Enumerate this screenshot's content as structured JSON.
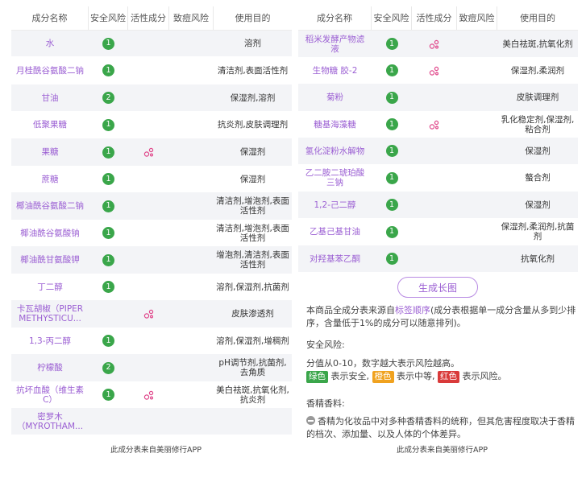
{
  "headers": {
    "name": "成分名称",
    "risk": "安全风险",
    "active": "活性成分",
    "acne": "致痘风险",
    "purpose": "使用目的"
  },
  "left_table": [
    {
      "name": "水",
      "risk": "1",
      "active": false,
      "purpose": "溶剂"
    },
    {
      "name": "月桂酰谷氨酸二钠",
      "risk": "1",
      "active": false,
      "purpose": "清洁剂,表面活性剂"
    },
    {
      "name": "甘油",
      "risk": "2",
      "active": false,
      "purpose": "保湿剂,溶剂"
    },
    {
      "name": "低聚果糖",
      "risk": "1",
      "active": false,
      "purpose": "抗炎剂,皮肤调理剂"
    },
    {
      "name": "果糖",
      "risk": "1",
      "active": true,
      "purpose": "保湿剂"
    },
    {
      "name": "蔗糖",
      "risk": "1",
      "active": false,
      "purpose": "保湿剂"
    },
    {
      "name": "椰油酰谷氨酸二钠",
      "risk": "1",
      "active": false,
      "purpose": "清洁剂,增泡剂,表面活性剂"
    },
    {
      "name": "椰油酰谷氨酸钠",
      "risk": "1",
      "active": false,
      "purpose": "清洁剂,增泡剂,表面活性剂"
    },
    {
      "name": "椰油酰甘氨酸钾",
      "risk": "1",
      "active": false,
      "purpose": "增泡剂,清洁剂,表面活性剂"
    },
    {
      "name": "丁二醇",
      "risk": "1",
      "active": false,
      "purpose": "溶剂,保湿剂,抗菌剂"
    },
    {
      "name": "卡瓦胡椒（PIPER METHYSTICU...",
      "risk": "",
      "active": true,
      "purpose": "皮肤渗透剂"
    },
    {
      "name": "1,3-丙二醇",
      "risk": "1",
      "active": false,
      "purpose": "溶剂,保湿剂,增稠剂"
    },
    {
      "name": "柠檬酸",
      "risk": "2",
      "active": false,
      "purpose": "pH调节剂,抗菌剂,去角质"
    },
    {
      "name": "抗坏血酸（维生素C）",
      "risk": "1",
      "active": true,
      "purpose": "美白祛斑,抗氧化剂,抗炎剂"
    },
    {
      "name": "密罗木（MYROTHAM...",
      "risk": "",
      "active": false,
      "purpose": ""
    }
  ],
  "right_table": [
    {
      "name": "稻米发酵产物滤液",
      "risk": "1",
      "active": true,
      "purpose": "美白祛斑,抗氧化剂"
    },
    {
      "name": "生物糖 胶-2",
      "risk": "1",
      "active": true,
      "purpose": "保湿剂,柔润剂"
    },
    {
      "name": "菊粉",
      "risk": "1",
      "active": false,
      "purpose": "皮肤调理剂"
    },
    {
      "name": "糖基海藻糖",
      "risk": "1",
      "active": true,
      "purpose": "乳化稳定剂,保湿剂,粘合剂"
    },
    {
      "name": "氢化淀粉水解物",
      "risk": "1",
      "active": false,
      "purpose": "保湿剂"
    },
    {
      "name": "乙二胺二琥珀酸三钠",
      "risk": "1",
      "active": false,
      "purpose": "螯合剂"
    },
    {
      "name": "1,2-己二醇",
      "risk": "1",
      "active": false,
      "purpose": "保湿剂"
    },
    {
      "name": "乙基己基甘油",
      "risk": "1",
      "active": false,
      "purpose": "保湿剂,柔润剂,抗菌剂"
    },
    {
      "name": "对羟基苯乙酮",
      "risk": "1",
      "active": false,
      "purpose": "抗氧化剂"
    }
  ],
  "footer_note": "此成分表来自美丽修行APP",
  "generate_button": "生成长图",
  "info": {
    "source_pre": "本商品全成分表来源自",
    "source_link": "标签顺序",
    "source_post": "(成分表根据单一成分含量从多到少排序，含量低于1%的成分可以随意排列)。",
    "risk_title": "安全风险:",
    "risk_desc": "分值从0-10，数字越大表示风险越高。",
    "green_tag": "绿色",
    "green_text": "表示安全,",
    "orange_tag": "橙色",
    "orange_text": "表示中等,",
    "red_tag": "红色",
    "red_text": "表示风险。",
    "fragrance_title": "香精香料:",
    "fragrance_desc": "香精为化妆品中对多种香精香料的统称，但其危害程度取决于香精的档次、添加量、以及人体的个体差异。"
  },
  "colors": {
    "accent": "#9b5fd3",
    "safe_green": "#3aa64a",
    "medium_orange": "#f0a21f",
    "risk_red": "#d93a3a",
    "active_pink": "#e0468a"
  },
  "icons": {
    "active": "active-ingredient-icon",
    "fragrance": "minus-circle-icon"
  }
}
